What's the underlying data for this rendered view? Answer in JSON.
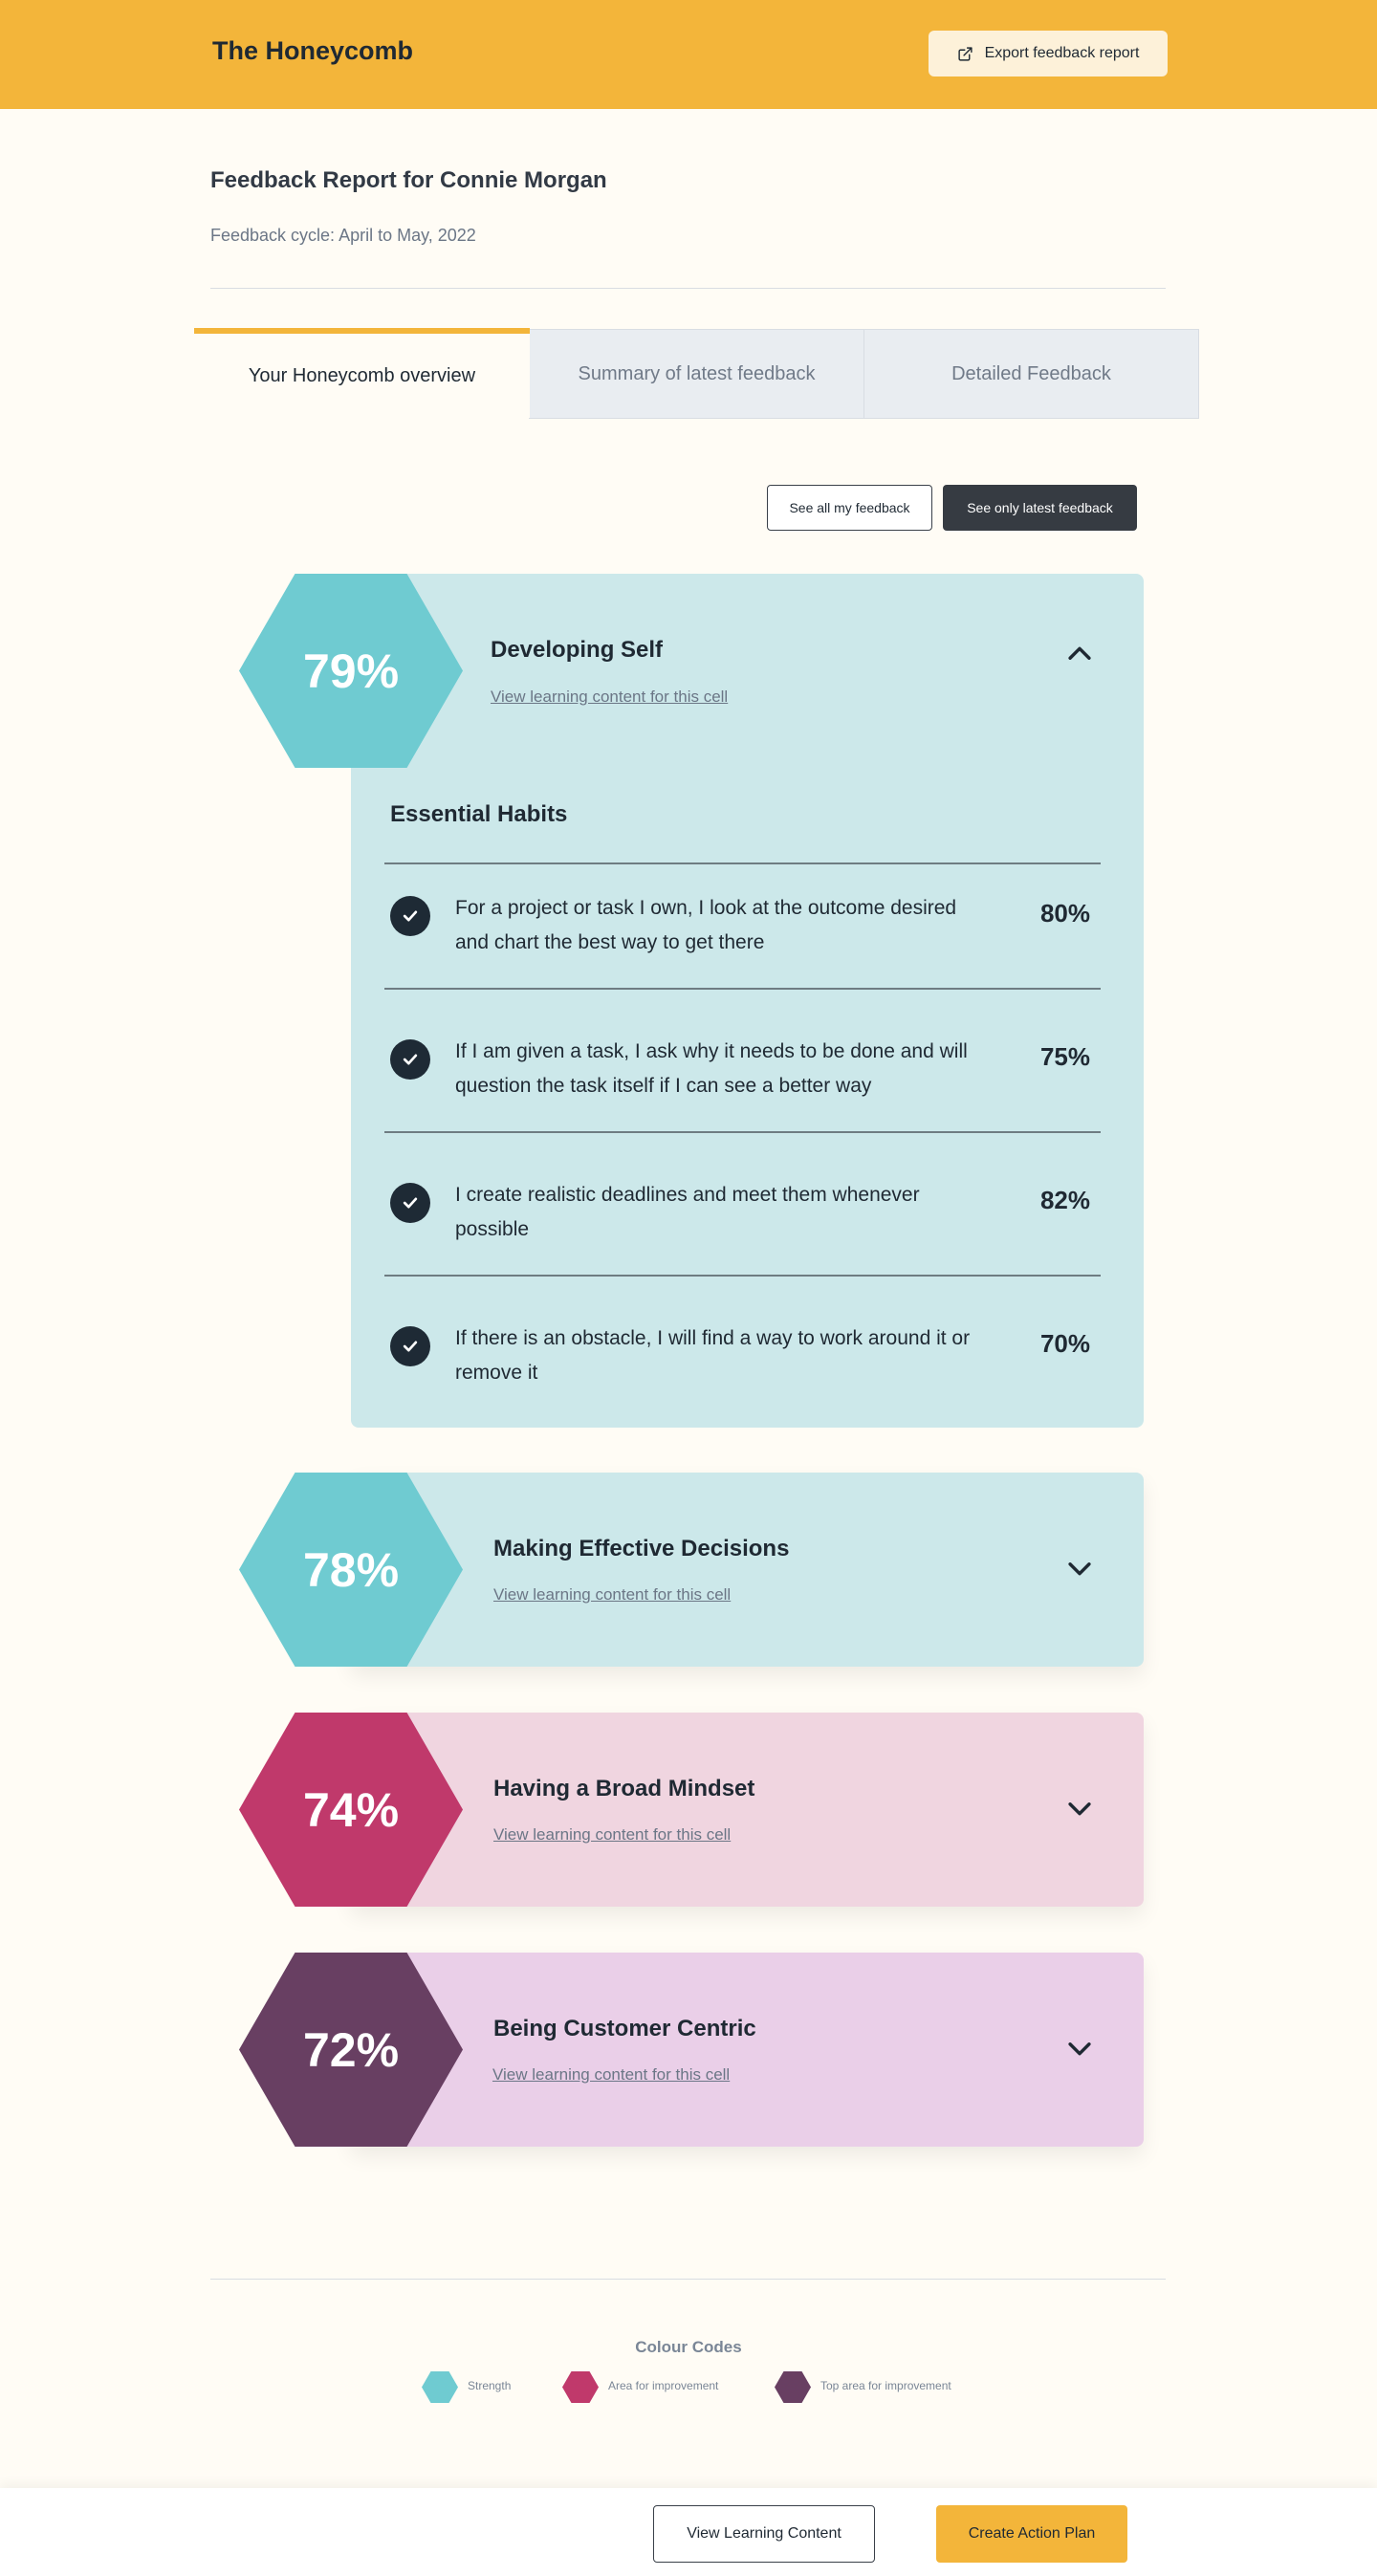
{
  "header": {
    "brand": "The Honeycomb",
    "export_label": "Export feedback report",
    "export_icon": "external-link-icon"
  },
  "report": {
    "title": "Feedback Report for Connie Morgan",
    "cycle": "Feedback cycle: April to May, 2022"
  },
  "tabs": [
    {
      "label": "Your Honeycomb overview",
      "active": true
    },
    {
      "label": "Summary of latest feedback",
      "active": false
    },
    {
      "label": "Detailed Feedback",
      "active": false
    }
  ],
  "filters": {
    "all_label": "See all my feedback",
    "latest_label": "See only latest feedback",
    "selected": "See only latest feedback"
  },
  "cells": [
    {
      "percent": "79%",
      "title": "Developing Self",
      "link": "View learning content for this cell",
      "color": "#6fcbd1",
      "card_color": "#cce8ea",
      "expanded": true
    },
    {
      "percent": "78%",
      "title": "Making Effective Decisions",
      "link": "View learning content for this cell",
      "color": "#6fcbd1",
      "card_color": "#cce8ea",
      "expanded": false
    },
    {
      "percent": "74%",
      "title": "Having a Broad Mindset",
      "link": "View learning content for this cell",
      "color": "#c0396b",
      "card_color": "#f0d5e0",
      "expanded": false
    },
    {
      "percent": "72%",
      "title": "Being Customer Centric",
      "link": "View learning content for this cell",
      "color": "#683f62",
      "card_color": "#eacfe8",
      "expanded": false
    }
  ],
  "expanded_section": {
    "title": "Essential Habits",
    "habits": [
      {
        "text": "For a project or task I own, I look at the outcome desired and chart the best way to get there",
        "percent": "80%"
      },
      {
        "text": "If I am given a task, I ask why it needs to be done and will question the task itself if I can see a better way",
        "percent": "75%"
      },
      {
        "text": "I create realistic deadlines and meet them whenever possible",
        "percent": "82%"
      },
      {
        "text": "If there is an obstacle, I will find a way to work around it or remove it",
        "percent": "70%"
      }
    ]
  },
  "legend": {
    "title": "Colour Codes",
    "items": [
      {
        "label": "Strength",
        "color": "#6fcbd1"
      },
      {
        "label": "Area for improvement",
        "color": "#c0396b"
      },
      {
        "label": "Top area for improvement",
        "color": "#683f62"
      }
    ]
  },
  "footer": {
    "learning_label": "View Learning Content",
    "plan_label": "Create Action Plan"
  }
}
